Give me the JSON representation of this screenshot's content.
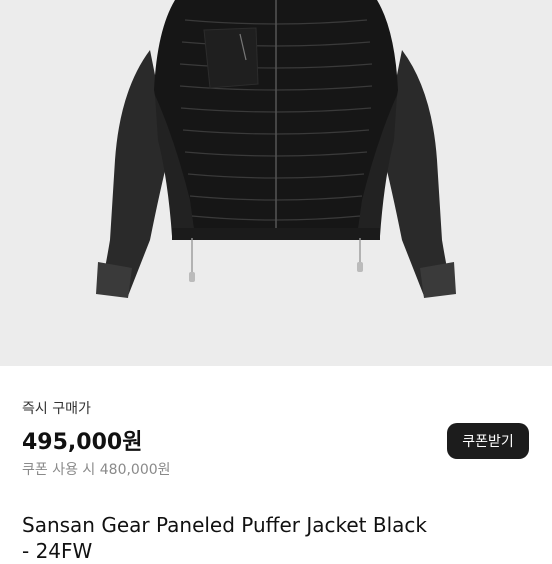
{
  "product": {
    "image_alt": "black puffer jacket",
    "purchase_label": "즉시 구매가",
    "price": "495,000원",
    "coupon_price": "쿠폰 사용 시 480,000원",
    "coupon_button_label": "쿠폰받기",
    "title": "Sansan Gear Paneled Puffer Jacket Black\n- 24FW"
  }
}
